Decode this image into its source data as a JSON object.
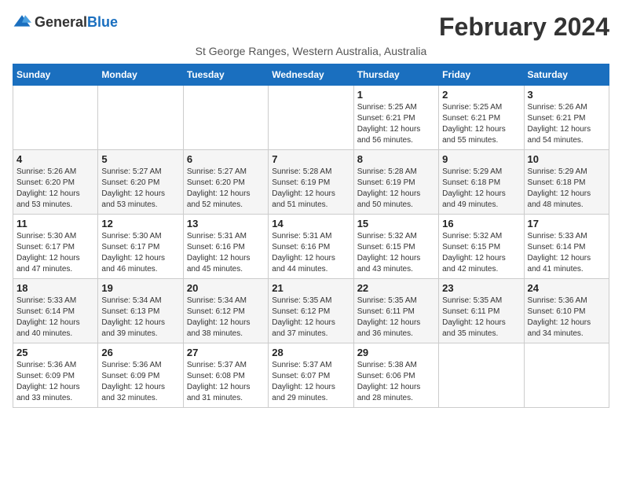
{
  "logo": {
    "general": "General",
    "blue": "Blue"
  },
  "title": "February 2024",
  "subtitle": "St George Ranges, Western Australia, Australia",
  "weekdays": [
    "Sunday",
    "Monday",
    "Tuesday",
    "Wednesday",
    "Thursday",
    "Friday",
    "Saturday"
  ],
  "weeks": [
    [
      {
        "day": "",
        "info": ""
      },
      {
        "day": "",
        "info": ""
      },
      {
        "day": "",
        "info": ""
      },
      {
        "day": "",
        "info": ""
      },
      {
        "day": "1",
        "info": "Sunrise: 5:25 AM\nSunset: 6:21 PM\nDaylight: 12 hours\nand 56 minutes."
      },
      {
        "day": "2",
        "info": "Sunrise: 5:25 AM\nSunset: 6:21 PM\nDaylight: 12 hours\nand 55 minutes."
      },
      {
        "day": "3",
        "info": "Sunrise: 5:26 AM\nSunset: 6:21 PM\nDaylight: 12 hours\nand 54 minutes."
      }
    ],
    [
      {
        "day": "4",
        "info": "Sunrise: 5:26 AM\nSunset: 6:20 PM\nDaylight: 12 hours\nand 53 minutes."
      },
      {
        "day": "5",
        "info": "Sunrise: 5:27 AM\nSunset: 6:20 PM\nDaylight: 12 hours\nand 53 minutes."
      },
      {
        "day": "6",
        "info": "Sunrise: 5:27 AM\nSunset: 6:20 PM\nDaylight: 12 hours\nand 52 minutes."
      },
      {
        "day": "7",
        "info": "Sunrise: 5:28 AM\nSunset: 6:19 PM\nDaylight: 12 hours\nand 51 minutes."
      },
      {
        "day": "8",
        "info": "Sunrise: 5:28 AM\nSunset: 6:19 PM\nDaylight: 12 hours\nand 50 minutes."
      },
      {
        "day": "9",
        "info": "Sunrise: 5:29 AM\nSunset: 6:18 PM\nDaylight: 12 hours\nand 49 minutes."
      },
      {
        "day": "10",
        "info": "Sunrise: 5:29 AM\nSunset: 6:18 PM\nDaylight: 12 hours\nand 48 minutes."
      }
    ],
    [
      {
        "day": "11",
        "info": "Sunrise: 5:30 AM\nSunset: 6:17 PM\nDaylight: 12 hours\nand 47 minutes."
      },
      {
        "day": "12",
        "info": "Sunrise: 5:30 AM\nSunset: 6:17 PM\nDaylight: 12 hours\nand 46 minutes."
      },
      {
        "day": "13",
        "info": "Sunrise: 5:31 AM\nSunset: 6:16 PM\nDaylight: 12 hours\nand 45 minutes."
      },
      {
        "day": "14",
        "info": "Sunrise: 5:31 AM\nSunset: 6:16 PM\nDaylight: 12 hours\nand 44 minutes."
      },
      {
        "day": "15",
        "info": "Sunrise: 5:32 AM\nSunset: 6:15 PM\nDaylight: 12 hours\nand 43 minutes."
      },
      {
        "day": "16",
        "info": "Sunrise: 5:32 AM\nSunset: 6:15 PM\nDaylight: 12 hours\nand 42 minutes."
      },
      {
        "day": "17",
        "info": "Sunrise: 5:33 AM\nSunset: 6:14 PM\nDaylight: 12 hours\nand 41 minutes."
      }
    ],
    [
      {
        "day": "18",
        "info": "Sunrise: 5:33 AM\nSunset: 6:14 PM\nDaylight: 12 hours\nand 40 minutes."
      },
      {
        "day": "19",
        "info": "Sunrise: 5:34 AM\nSunset: 6:13 PM\nDaylight: 12 hours\nand 39 minutes."
      },
      {
        "day": "20",
        "info": "Sunrise: 5:34 AM\nSunset: 6:12 PM\nDaylight: 12 hours\nand 38 minutes."
      },
      {
        "day": "21",
        "info": "Sunrise: 5:35 AM\nSunset: 6:12 PM\nDaylight: 12 hours\nand 37 minutes."
      },
      {
        "day": "22",
        "info": "Sunrise: 5:35 AM\nSunset: 6:11 PM\nDaylight: 12 hours\nand 36 minutes."
      },
      {
        "day": "23",
        "info": "Sunrise: 5:35 AM\nSunset: 6:11 PM\nDaylight: 12 hours\nand 35 minutes."
      },
      {
        "day": "24",
        "info": "Sunrise: 5:36 AM\nSunset: 6:10 PM\nDaylight: 12 hours\nand 34 minutes."
      }
    ],
    [
      {
        "day": "25",
        "info": "Sunrise: 5:36 AM\nSunset: 6:09 PM\nDaylight: 12 hours\nand 33 minutes."
      },
      {
        "day": "26",
        "info": "Sunrise: 5:36 AM\nSunset: 6:09 PM\nDaylight: 12 hours\nand 32 minutes."
      },
      {
        "day": "27",
        "info": "Sunrise: 5:37 AM\nSunset: 6:08 PM\nDaylight: 12 hours\nand 31 minutes."
      },
      {
        "day": "28",
        "info": "Sunrise: 5:37 AM\nSunset: 6:07 PM\nDaylight: 12 hours\nand 29 minutes."
      },
      {
        "day": "29",
        "info": "Sunrise: 5:38 AM\nSunset: 6:06 PM\nDaylight: 12 hours\nand 28 minutes."
      },
      {
        "day": "",
        "info": ""
      },
      {
        "day": "",
        "info": ""
      }
    ]
  ]
}
